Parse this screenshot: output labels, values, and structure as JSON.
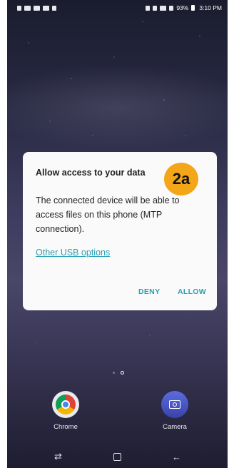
{
  "status_bar": {
    "battery": "93%",
    "time": "3:10 PM"
  },
  "dialog": {
    "title": "Allow access to your data",
    "body": "The connected device will be able to access files on this phone (MTP connection).",
    "link": "Other USB options",
    "deny_label": "DENY",
    "allow_label": "ALLOW"
  },
  "badge": {
    "label": "2a",
    "color": "#f4a619"
  },
  "dock": {
    "apps": [
      {
        "label": "Chrome",
        "icon": "chrome-icon"
      },
      {
        "label": "Camera",
        "icon": "camera-icon"
      }
    ]
  },
  "navbar": {
    "buttons": [
      "recent-apps-icon",
      "home-icon",
      "back-icon"
    ]
  },
  "colors": {
    "accent": "#2a9fb3",
    "dialog_bg": "#fafafa"
  }
}
